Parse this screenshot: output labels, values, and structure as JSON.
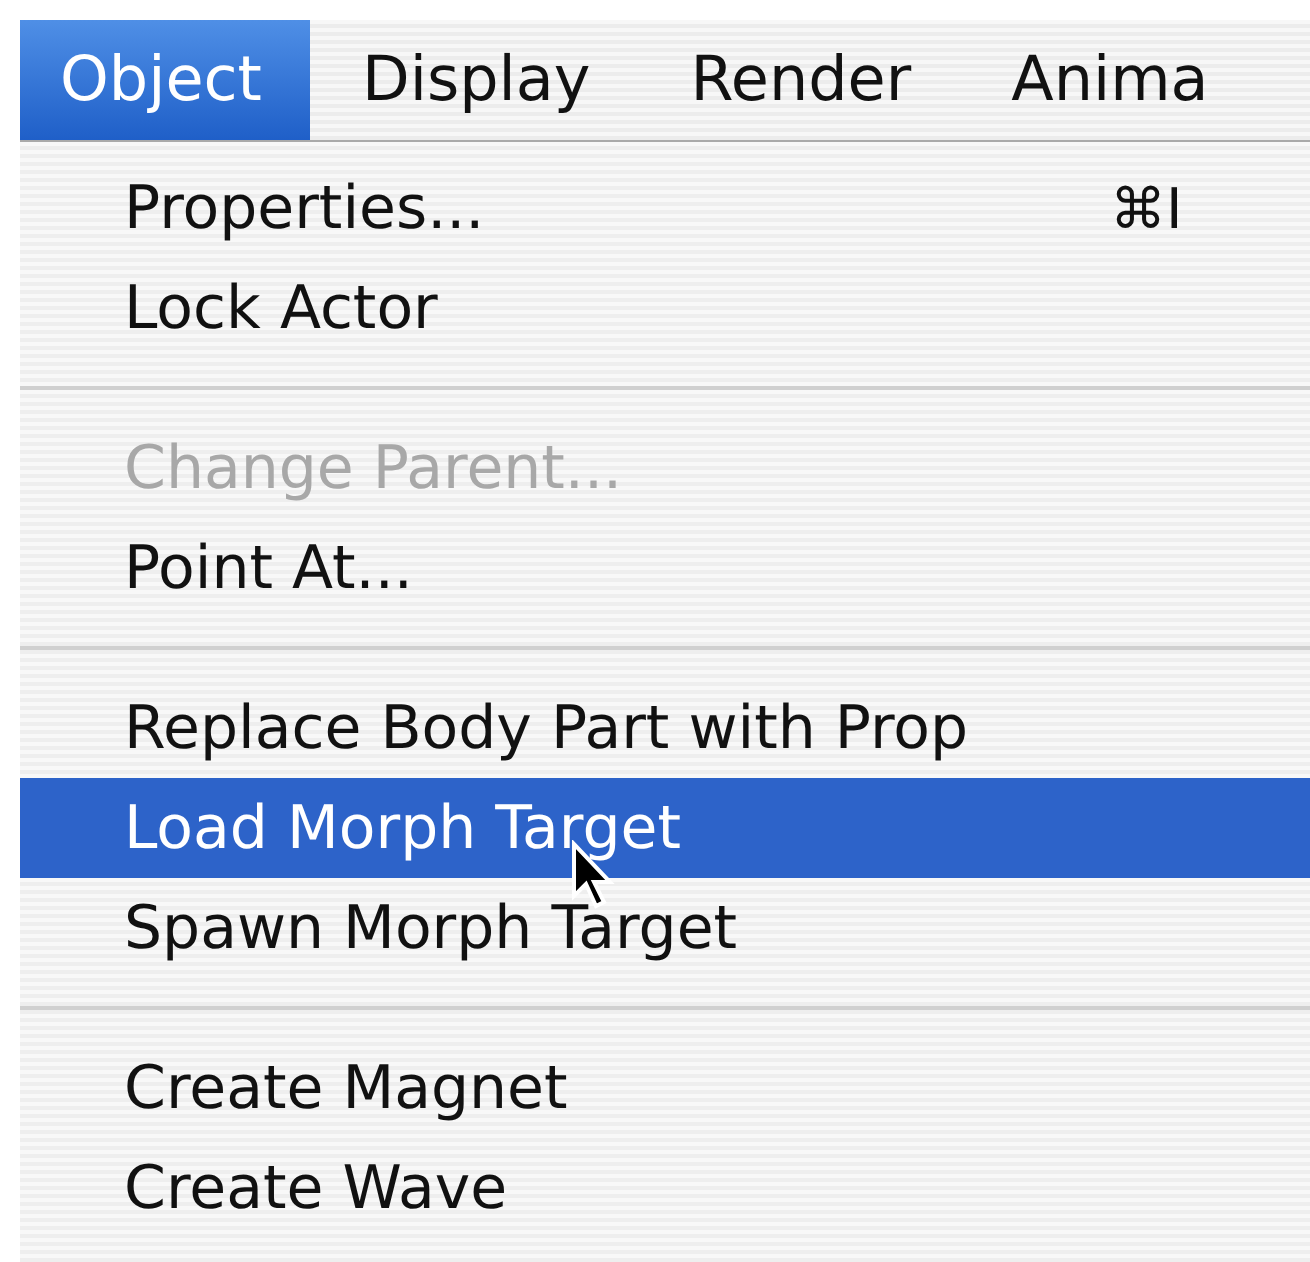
{
  "menubar": {
    "items": [
      {
        "label": "Object",
        "selected": true
      },
      {
        "label": "Display",
        "selected": false
      },
      {
        "label": "Render",
        "selected": false
      },
      {
        "label": "Anima",
        "selected": false
      }
    ]
  },
  "menu": {
    "items": [
      {
        "kind": "item",
        "label": "Properties...",
        "shortcut": "⌘I",
        "disabled": false,
        "selected": false
      },
      {
        "kind": "item",
        "label": "Lock Actor",
        "disabled": false,
        "selected": false
      },
      {
        "kind": "separator"
      },
      {
        "kind": "item",
        "label": "Change Parent...",
        "disabled": true,
        "selected": false
      },
      {
        "kind": "item",
        "label": "Point At...",
        "disabled": false,
        "selected": false
      },
      {
        "kind": "separator"
      },
      {
        "kind": "item",
        "label": "Replace Body Part with Prop",
        "disabled": false,
        "selected": false
      },
      {
        "kind": "item",
        "label": "Load Morph Target",
        "disabled": false,
        "selected": true
      },
      {
        "kind": "item",
        "label": "Spawn Morph Target",
        "disabled": false,
        "selected": false
      },
      {
        "kind": "separator"
      },
      {
        "kind": "item",
        "label": "Create Magnet",
        "disabled": false,
        "selected": false
      },
      {
        "kind": "item",
        "label": "Create Wave",
        "disabled": false,
        "selected": false
      }
    ]
  }
}
